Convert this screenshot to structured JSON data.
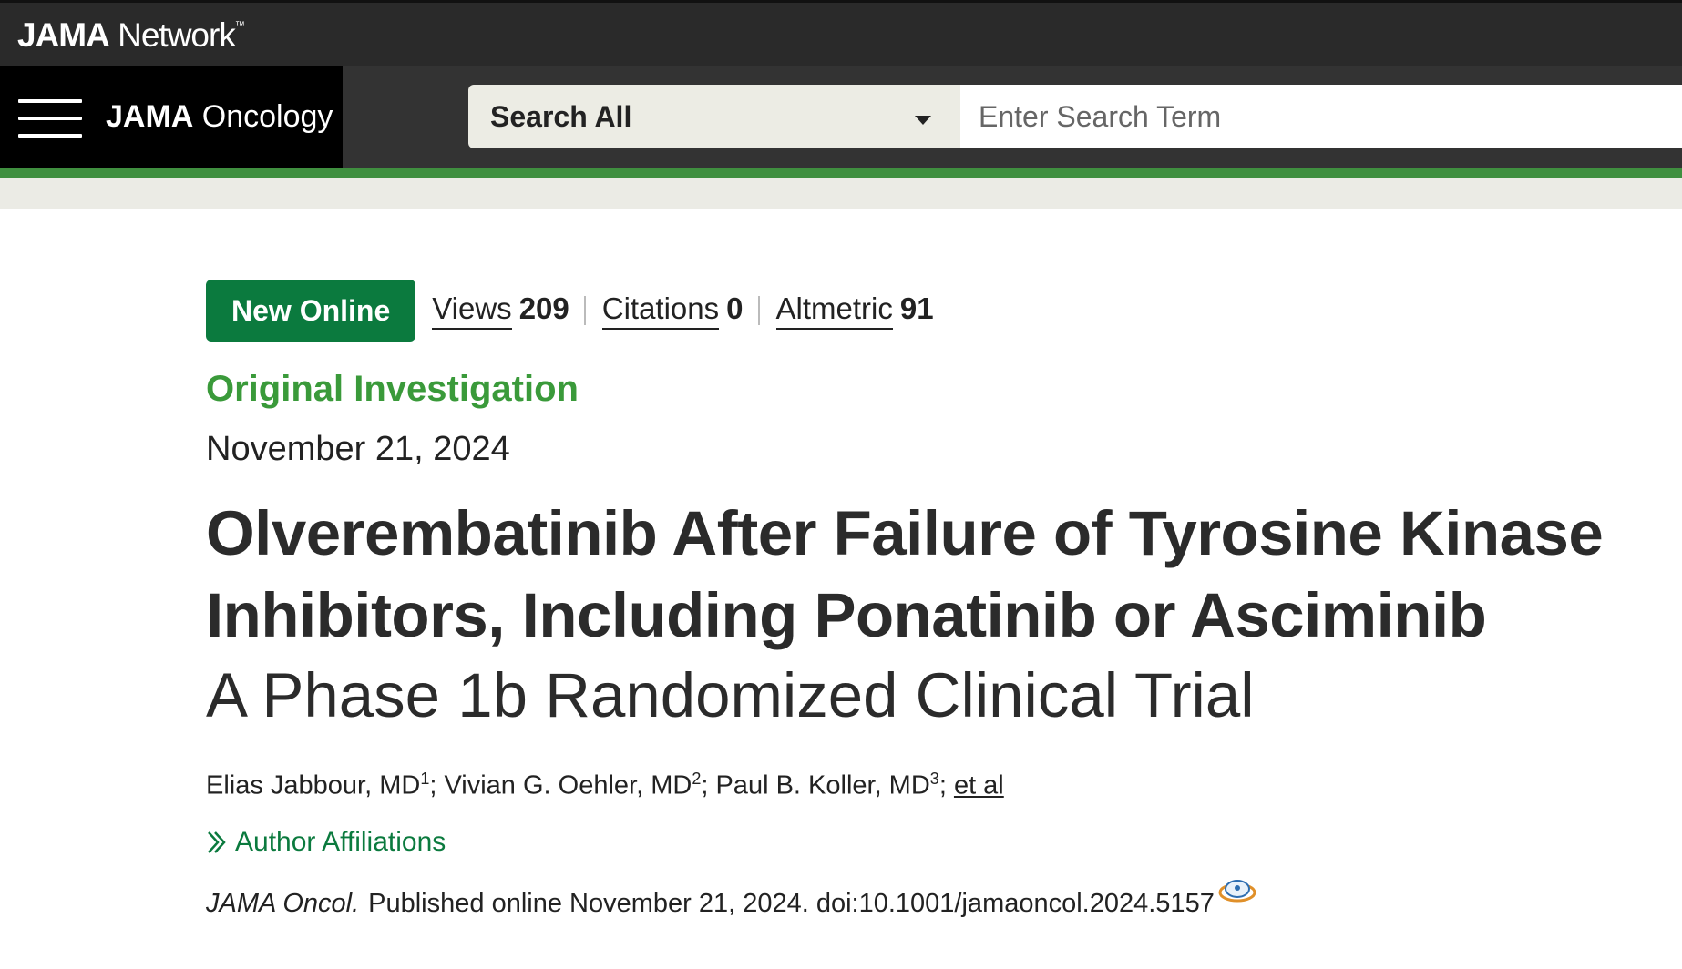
{
  "network": {
    "logo_bold": "JAMA",
    "logo_rest": " Network",
    "logo_tm": "™"
  },
  "journal": {
    "name_bold": "JAMA",
    "name_rest": " Oncology"
  },
  "search": {
    "scope": "Search All",
    "placeholder": "Enter Search Term"
  },
  "article": {
    "badge": "New Online",
    "metrics": [
      {
        "label": "Views",
        "value": "209"
      },
      {
        "label": "Citations",
        "value": "0"
      },
      {
        "label": "Altmetric",
        "value": "91"
      }
    ],
    "type": "Original Investigation",
    "date": "November 21, 2024",
    "title_line1": "Olverembatinib After Failure of Tyrosine Kinase",
    "title_line2": "Inhibitors, Including Ponatinib or Asciminib",
    "subtitle": "A Phase 1b Randomized Clinical Trial",
    "authors": [
      {
        "name": "Elias Jabbour, MD",
        "sup": "1"
      },
      {
        "name": "Vivian G. Oehler, MD",
        "sup": "2"
      },
      {
        "name": "Paul B. Koller, MD",
        "sup": "3"
      }
    ],
    "et_al": "et al",
    "affiliations_label": "Author Affiliations",
    "citation_journal": "JAMA Oncol.",
    "citation_text": "Published online November 21, 2024. doi:10.1001/jamaoncol.2024.5157"
  },
  "colors": {
    "badge_green": "#0b7a3e",
    "type_green": "#3a9a3a",
    "rule_green": "#3f8f3f",
    "top_bar": "#2a2a2a"
  },
  "icons": [
    "hamburger-menu-icon",
    "chevron-down-icon",
    "double-chevron-right-icon",
    "altmetric-icon"
  ]
}
